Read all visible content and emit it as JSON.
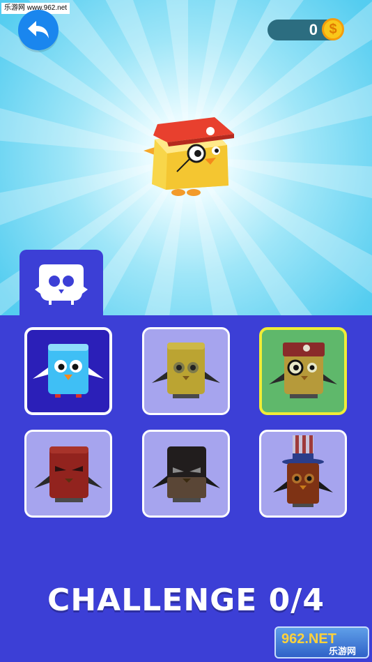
{
  "watermark": {
    "text": "乐游网 www.962.net"
  },
  "header": {
    "back_icon": "back-arrow-icon",
    "coins": "0",
    "coin_symbol": "$"
  },
  "category": {
    "icon": "skin-mask-icon"
  },
  "skins": [
    {
      "name": "blue-bird",
      "state": "selected",
      "color": "#3fbff5"
    },
    {
      "name": "yellow-bird-locked",
      "state": "locked",
      "color": "#cbb63a"
    },
    {
      "name": "pirate-bird",
      "state": "equipped",
      "color": "#e3b42f"
    },
    {
      "name": "red-angry-bird-locked",
      "state": "locked",
      "color": "#b0271f"
    },
    {
      "name": "black-bird-locked",
      "state": "locked",
      "color": "#2a2626"
    },
    {
      "name": "uncle-sam-bird-locked",
      "state": "locked",
      "color": "#c2581b"
    }
  ],
  "challenge": {
    "text": "CHALLENGE 0/4"
  },
  "site_logo": {
    "text_top": "962.NET",
    "text_bottom": "乐游网"
  }
}
